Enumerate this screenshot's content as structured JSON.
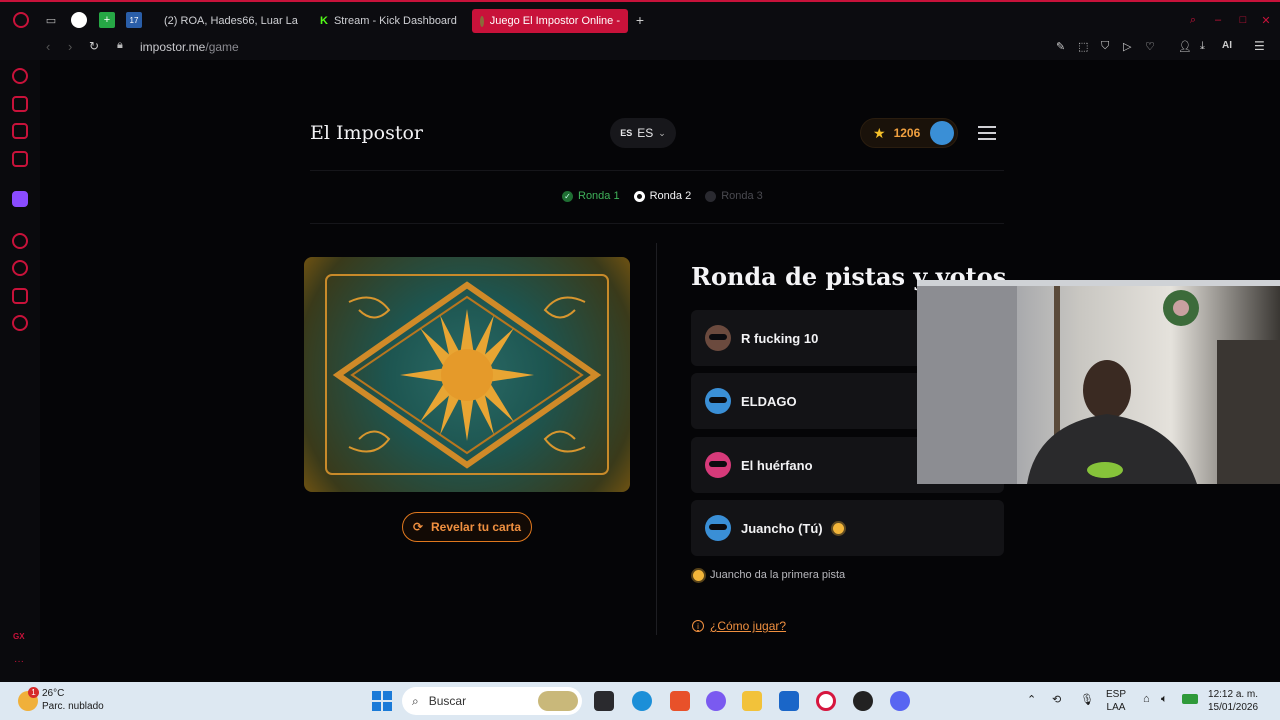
{
  "browser": {
    "tabs": [
      {
        "label": "(2) ROA, Hades66, Luar La",
        "icon": "youtube-icon",
        "active": false
      },
      {
        "label": "Stream - Kick Dashboard",
        "icon": "kick-icon",
        "active": false
      },
      {
        "label": "Juego El Impostor Online -",
        "icon": "impostor-icon",
        "active": true
      }
    ],
    "url_host": "impostor.me",
    "url_path": "/game",
    "toolbar_ai": "AI"
  },
  "header": {
    "brand": "El Impostor",
    "lang_flag": "ES",
    "lang_code": "ES",
    "coins": "1206"
  },
  "rounds": [
    {
      "label": "Ronda 1",
      "state": "done"
    },
    {
      "label": "Ronda 2",
      "state": "current"
    },
    {
      "label": "Ronda 3",
      "state": "upcoming"
    }
  ],
  "card": {
    "reveal_label": "Revelar tu carta"
  },
  "panel": {
    "title": "Ronda de pistas y votos",
    "players": [
      {
        "name": "R fucking 10",
        "color": "#6b4a3e"
      },
      {
        "name": "ELDAGO",
        "color": "#3a8fd6"
      },
      {
        "name": "El huérfano",
        "color": "#d63a7a"
      },
      {
        "name": "Juancho (Tú)",
        "color": "#3a8fd6",
        "first": true
      }
    ],
    "hint": "Juancho da la primera pista",
    "howto": "¿Cómo jugar?"
  },
  "taskbar": {
    "temp": "26°C",
    "condition": "Parc. nublado",
    "search_placeholder": "Buscar",
    "lang1": "ESP",
    "lang2": "LAA",
    "time": "12:12 a. m.",
    "date": "15/01/2026"
  },
  "colors": {
    "accent": "#c8123a",
    "orange": "#f09040",
    "green": "#4caf50"
  }
}
